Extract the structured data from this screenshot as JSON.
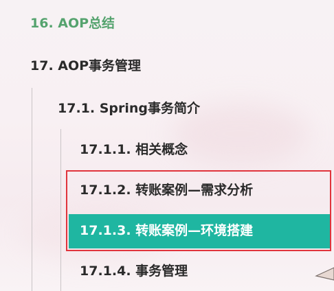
{
  "toc": {
    "items": [
      {
        "label": "16. AOP总结",
        "level": 1,
        "state": "visited"
      },
      {
        "label": "17. AOP事务管理",
        "level": 1,
        "state": "normal"
      },
      {
        "label": "17.1. Spring事务简介",
        "level": 2,
        "state": "normal"
      },
      {
        "label": "17.1.1. 相关概念",
        "level": 3,
        "state": "normal"
      },
      {
        "label": "17.1.2. 转账案例—需求分析",
        "level": 3,
        "state": "normal"
      },
      {
        "label": "17.1.3. 转账案例—环境搭建",
        "level": 3,
        "state": "active"
      },
      {
        "label": "17.1.4. 事务管理",
        "level": 3,
        "state": "normal"
      }
    ]
  },
  "colors": {
    "visited_link": "#55a36e",
    "active_background": "#1fb6a1",
    "active_text": "#ffffff",
    "annotation_box": "#e0343c",
    "text": "#2a2a2a"
  }
}
